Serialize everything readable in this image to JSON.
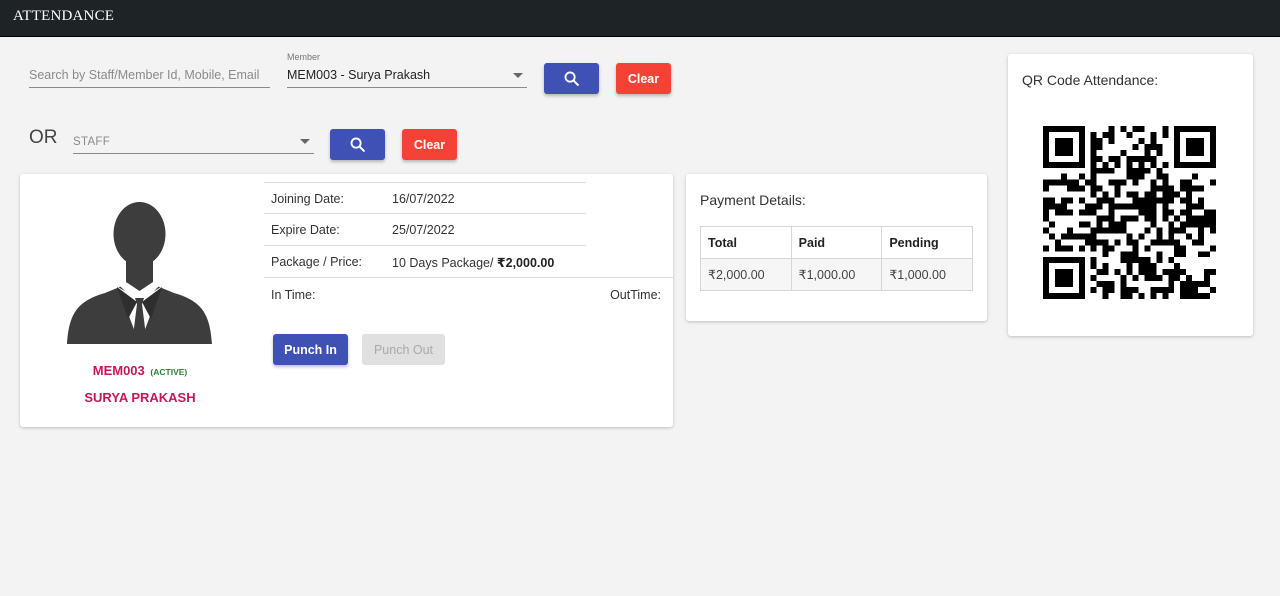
{
  "header": {
    "title": "ATTENDANCE"
  },
  "search": {
    "placeholder": "Search by Staff/Member Id, Mobile, Email",
    "member_label": "Member",
    "member_value": "MEM003 - Surya Prakash",
    "clear_label": "Clear",
    "search_icon": "search-icon"
  },
  "staff_search": {
    "or_label": "OR",
    "staff_placeholder": "STAFF",
    "clear_label": "Clear"
  },
  "member": {
    "id": "MEM003",
    "status": "(ACTIVE)",
    "name": "SURYA PRAKASH",
    "joining_label": "Joining Date:",
    "joining_value": "16/07/2022",
    "expire_label": "Expire Date:",
    "expire_value": "25/07/2022",
    "package_label": "Package / Price:",
    "package_value": "10 Days Package/ ",
    "package_price": "₹2,000.00",
    "in_time_label": "In Time:",
    "out_time_label": "OutTime:",
    "punch_in_label": "Punch In",
    "punch_out_label": "Punch Out"
  },
  "payment": {
    "title": "Payment Details:",
    "headers": [
      "Total",
      "Paid",
      "Pending"
    ],
    "row": [
      "₹2,000.00",
      "₹1,000.00",
      "₹1,000.00"
    ]
  },
  "qr": {
    "title": "QR Code Attendance:"
  },
  "colors": {
    "primary": "#3f51b5",
    "danger": "#f44336",
    "member_name": "#c2185b",
    "active_status": "#2e7d32",
    "header_bg": "#1e2326"
  }
}
